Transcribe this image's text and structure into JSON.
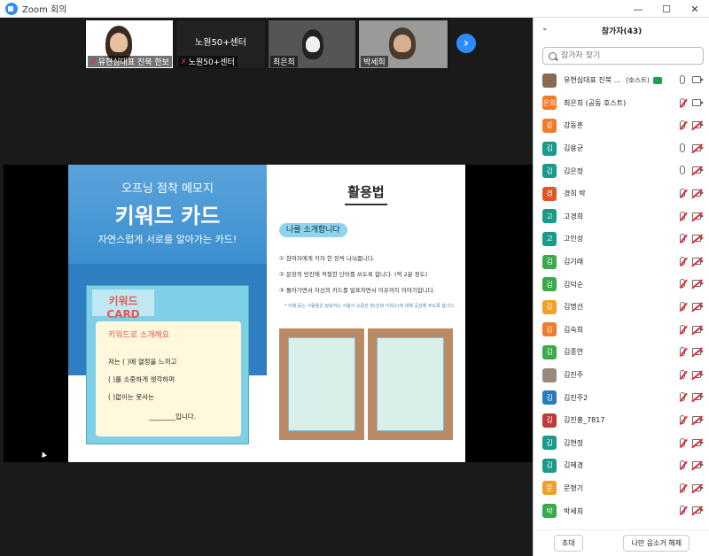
{
  "window": {
    "title": "Zoom 회의",
    "controls": [
      "—",
      "☐",
      "✕"
    ]
  },
  "thumbnails": [
    {
      "name": "유현심대표 진북 한보",
      "muted": true
    },
    {
      "name": "노원50+센터",
      "label": "노원50+센터",
      "muted": true
    },
    {
      "name": "최은희",
      "muted": false
    },
    {
      "name": "박세희",
      "muted": false
    }
  ],
  "slide": {
    "subtitle": "오프닝 점착 메모지",
    "title": "키워드 카드",
    "description": "자연스럽게 서로를 알아가는 카드!",
    "card_logo": "키워드 CARD",
    "card_heading": "키워드로 소개해요",
    "card_lines": [
      "저는 (          )에 열정을 느끼고",
      "(          )를 소중하게 생각하며",
      "(          )없이는 못사는",
      "________입니다."
    ],
    "howto_title": "활용법",
    "pill": "나를 소개합니다",
    "steps": [
      "① 참여자에게 각자 한 장씩 나눠줍니다.",
      "② 문장의 빈칸에 적절한 단어를 쓰도록 합니다. (약 2분 정도)",
      "③ 돌아가면서 자신의 카드를 발표하면서 이유까지 이야기합니다."
    ],
    "note": "* 이때 듣는 사람들은 발표하는 사람의 소중한 점(선택 키워드)에 대해 공감해 주도록 합니다."
  },
  "panel": {
    "title": "참가자(43)",
    "search_placeholder": "참가자 찾기",
    "participants": [
      {
        "initial": "",
        "color": "#8a6a50",
        "name": "유현심대표 진북 ...",
        "tag": "(호스트)",
        "host_badge": true,
        "mic": "on",
        "cam": "on"
      },
      {
        "initial": "은희",
        "color": "#f07b2a",
        "name": "최은희 (공동 호스트)",
        "tag": "",
        "mic": "muted",
        "cam": "on"
      },
      {
        "initial": "강",
        "color": "#f07b2a",
        "name": "강동훈",
        "tag": "",
        "mic": "muted",
        "cam": "off"
      },
      {
        "initial": "김",
        "color": "#1a9a8a",
        "name": "김용균",
        "tag": "",
        "mic": "on",
        "cam": "off"
      },
      {
        "initial": "김",
        "color": "#1a9a8a",
        "name": "김은정",
        "tag": "",
        "mic": "on",
        "cam": "off"
      },
      {
        "initial": "경",
        "color": "#e0562a",
        "name": "경희 박",
        "tag": "",
        "mic": "muted",
        "cam": "off"
      },
      {
        "initial": "고",
        "color": "#1a9a8a",
        "name": "고경희",
        "tag": "",
        "mic": "muted",
        "cam": "off"
      },
      {
        "initial": "고",
        "color": "#1a9a8a",
        "name": "고인성",
        "tag": "",
        "mic": "muted",
        "cam": "off"
      },
      {
        "initial": "김",
        "color": "#3aaa4a",
        "name": "김기래",
        "tag": "",
        "mic": "muted",
        "cam": "off"
      },
      {
        "initial": "김",
        "color": "#3aaa4a",
        "name": "김덕순",
        "tag": "",
        "mic": "muted",
        "cam": "off"
      },
      {
        "initial": "김",
        "color": "#f0a02a",
        "name": "김명선",
        "tag": "",
        "mic": "muted",
        "cam": "off"
      },
      {
        "initial": "김",
        "color": "#f07b2a",
        "name": "김숙희",
        "tag": "",
        "mic": "muted",
        "cam": "off"
      },
      {
        "initial": "김",
        "color": "#3aaa4a",
        "name": "김종연",
        "tag": "",
        "mic": "muted",
        "cam": "off"
      },
      {
        "initial": "",
        "color": "#9a8a7a",
        "name": "김진주",
        "tag": "",
        "mic": "muted",
        "cam": "off"
      },
      {
        "initial": "김",
        "color": "#2a7ac0",
        "name": "김진주2",
        "tag": "",
        "mic": "muted",
        "cam": "off"
      },
      {
        "initial": "김",
        "color": "#c03a3a",
        "name": "김진홍_7817",
        "tag": "",
        "mic": "muted",
        "cam": "off"
      },
      {
        "initial": "김",
        "color": "#1a9a8a",
        "name": "김현정",
        "tag": "",
        "mic": "muted",
        "cam": "off"
      },
      {
        "initial": "김",
        "color": "#1a9a8a",
        "name": "김혜경",
        "tag": "",
        "mic": "muted",
        "cam": "off"
      },
      {
        "initial": "문",
        "color": "#f0a02a",
        "name": "문형기",
        "tag": "",
        "mic": "muted",
        "cam": "off"
      },
      {
        "initial": "박",
        "color": "#3aaa4a",
        "name": "박세희",
        "tag": "",
        "mic": "muted",
        "cam": "off"
      }
    ],
    "invite_label": "초대",
    "unmute_me_label": "나만 음소거 해제"
  }
}
